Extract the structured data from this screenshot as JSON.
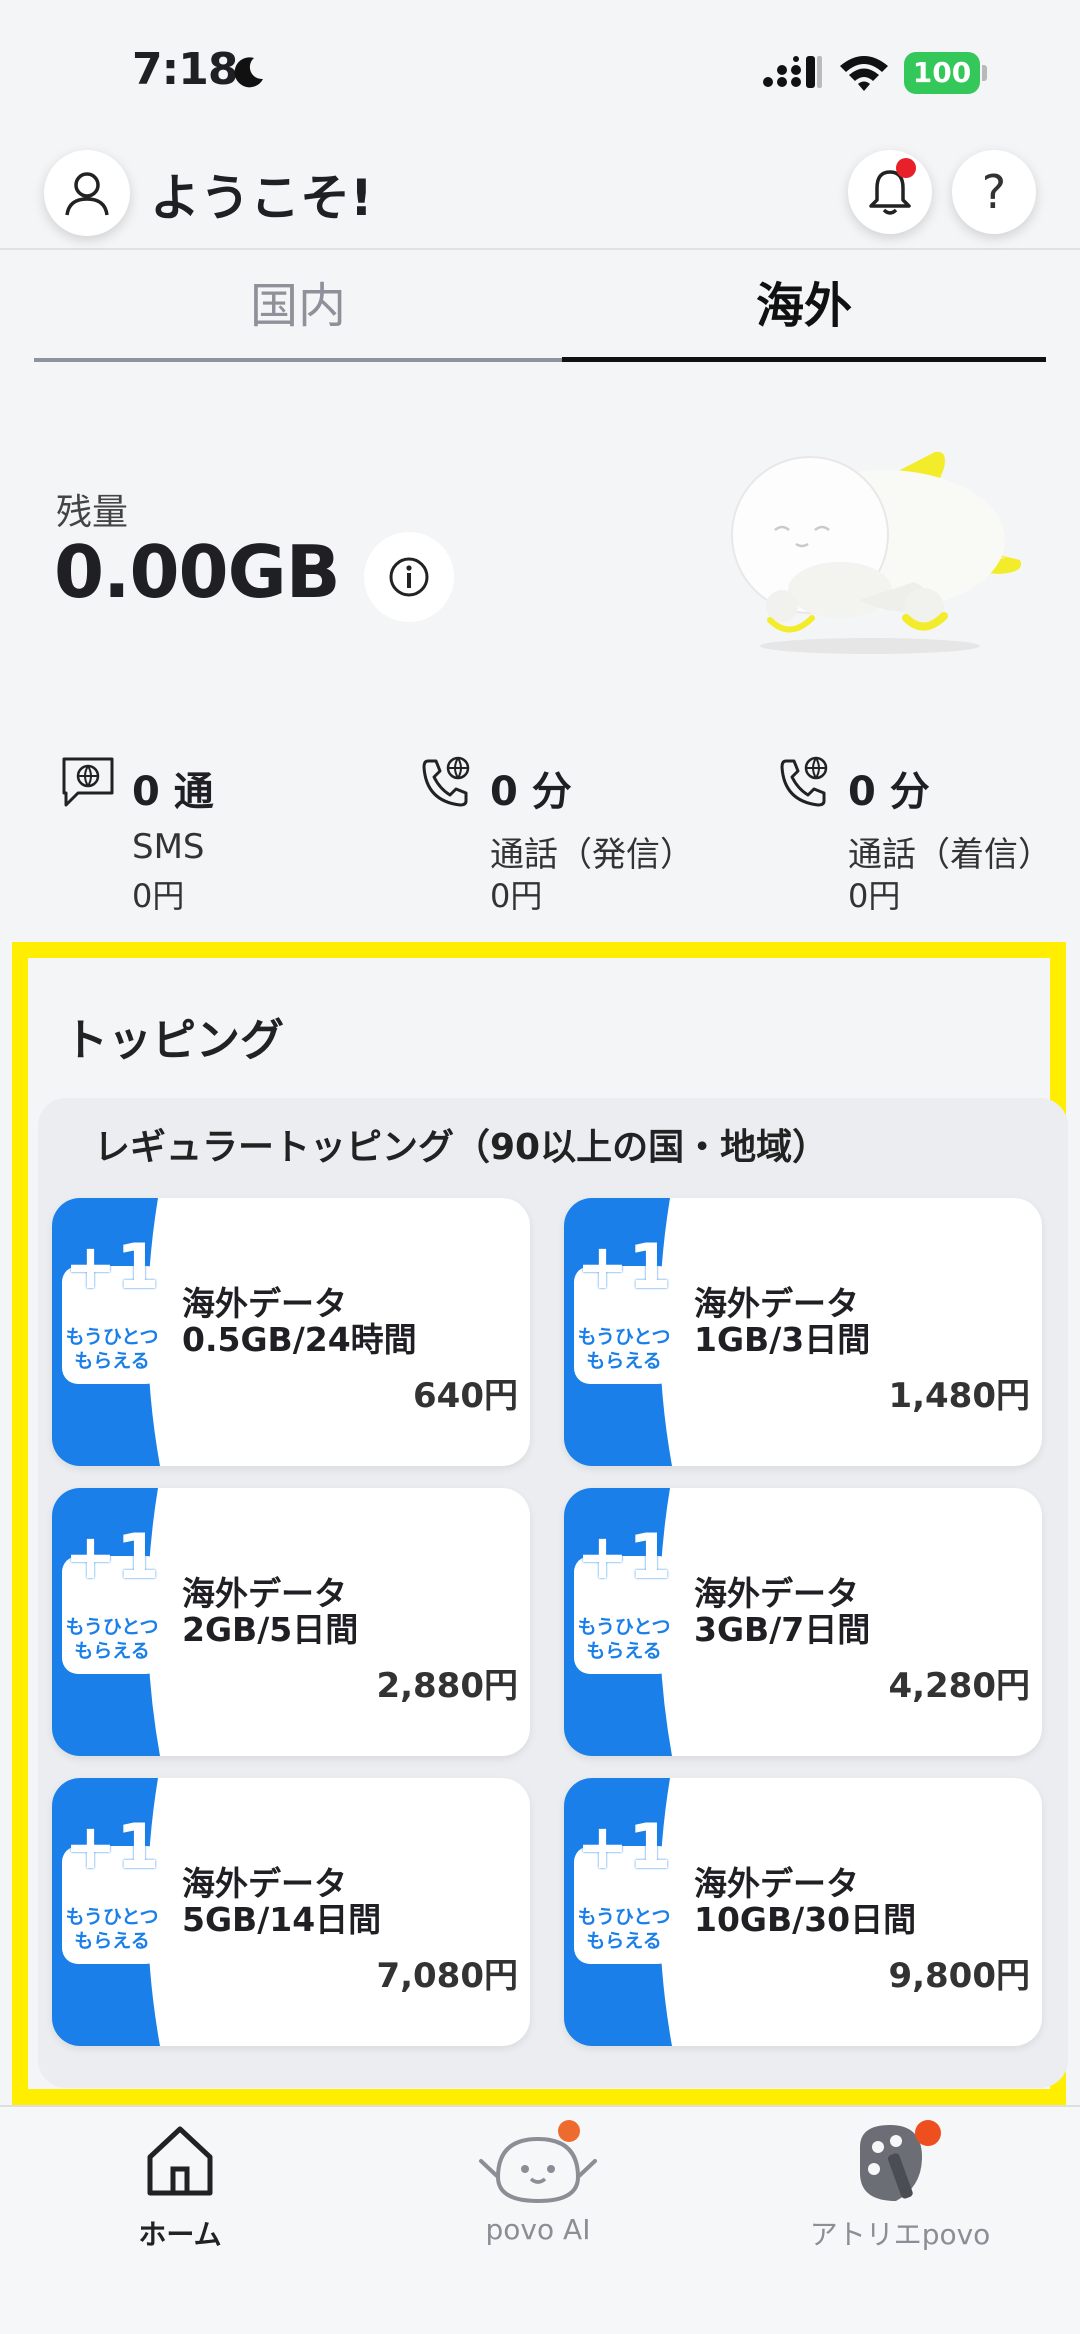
{
  "status_bar": {
    "time": "7:18",
    "battery": "100"
  },
  "header": {
    "welcome": "ようこそ!",
    "help_glyph": "?"
  },
  "tabs": [
    {
      "label": "国内",
      "active": false
    },
    {
      "label": "海外",
      "active": true
    }
  ],
  "remaining": {
    "label": "残量",
    "value": "0.00GB"
  },
  "usage": [
    {
      "count": "0 通",
      "name": "SMS",
      "price": "0円",
      "icon": "sms-globe-icon"
    },
    {
      "count": "0 分",
      "name": "通話（発信）",
      "price": "0円",
      "icon": "phone-globe-icon"
    },
    {
      "count": "0 分",
      "name": "通話（着信）",
      "price": "0円",
      "icon": "phone-globe-icon"
    }
  ],
  "topping": {
    "title": "トッピング",
    "panel_title": "レギュラートッピング（90以上の国・地域）",
    "badge": {
      "plus": "+1",
      "line1": "もうひとつ",
      "line2": "もらえる"
    },
    "cards": [
      {
        "name_line1": "海外データ",
        "name_line2": "0.5GB/24時間",
        "price": "640円"
      },
      {
        "name_line1": "海外データ",
        "name_line2": "1GB/3日間",
        "price": "1,480円"
      },
      {
        "name_line1": "海外データ",
        "name_line2": "2GB/5日間",
        "price": "2,880円"
      },
      {
        "name_line1": "海外データ",
        "name_line2": "3GB/7日間",
        "price": "4,280円"
      },
      {
        "name_line1": "海外データ",
        "name_line2": "5GB/14日間",
        "price": "7,080円"
      },
      {
        "name_line1": "海外データ",
        "name_line2": "10GB/30日間",
        "price": "9,800円"
      }
    ]
  },
  "bottom_nav": [
    {
      "label": "ホーム",
      "active": true
    },
    {
      "label": "povo AI",
      "active": false
    },
    {
      "label": "アトリエpovo",
      "active": false
    }
  ],
  "colors": {
    "accent_blue": "#1a7fe8",
    "highlight_yellow": "#ffee00",
    "notification_red": "#e8202a",
    "battery_green": "#34c759"
  }
}
